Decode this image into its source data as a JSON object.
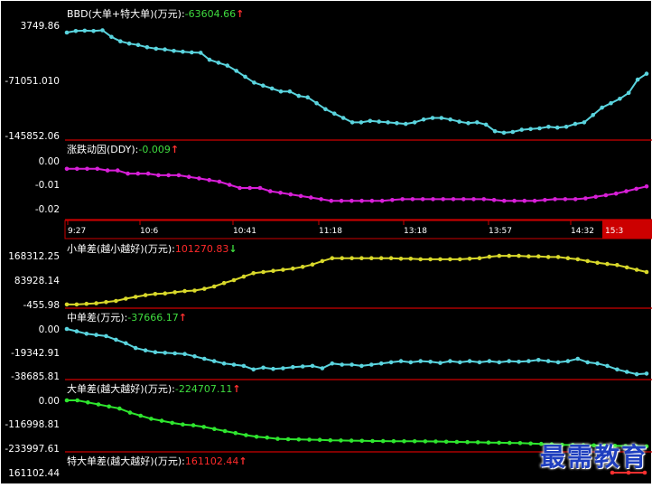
{
  "colors": {
    "background": "#000000",
    "frame": "#ffffff",
    "divider": "#cc0000",
    "axis_text": "#ffffff",
    "positive_value": "#ff2a2a",
    "negative_value": "#3fdc3f",
    "arrow_red": "#ff3030",
    "arrow_green": "#3fdc3f",
    "watermark": "#1f3fbf"
  },
  "watermark": "最需教育",
  "time_axis": {
    "labels": [
      "9:27",
      "10:6",
      "10:41",
      "11:18",
      "13:18",
      "13:57",
      "14:32",
      "15:3"
    ],
    "highlight": "15:3"
  },
  "chart_data": [
    {
      "type": "line",
      "id": "bbd",
      "label": "BBD(大单+特大单)(万元):",
      "value_text": "-63604.66",
      "arrow": "↑",
      "value_color": "#3fdc3f",
      "arrow_color": "#ff3030",
      "color": "#5ad4de",
      "y_ticks": [
        "3749.86",
        "-71051.010",
        "-145852.06"
      ],
      "ylim": [
        -145852.06,
        3749.86
      ],
      "values": [
        -6000,
        -4000,
        -3500,
        -4000,
        -3000,
        -12000,
        -18000,
        -21000,
        -23000,
        -26000,
        -28000,
        -29000,
        -31000,
        -32000,
        -33000,
        -33500,
        -43000,
        -47000,
        -51000,
        -58000,
        -66000,
        -74000,
        -78000,
        -82000,
        -86000,
        -86000,
        -92000,
        -94000,
        -102000,
        -110000,
        -116000,
        -122000,
        -128000,
        -128000,
        -126000,
        -127000,
        -128000,
        -129000,
        -130000,
        -128000,
        -124000,
        -122000,
        -122000,
        -124000,
        -127000,
        -129000,
        -128000,
        -131000,
        -140000,
        -142000,
        -141000,
        -138000,
        -137000,
        -136000,
        -134000,
        -135000,
        -134000,
        -130000,
        -128000,
        -118000,
        -108000,
        -102000,
        -96000,
        -88000,
        -70000,
        -62000
      ]
    },
    {
      "type": "line",
      "id": "ddy",
      "label": "涨跌动因(DDY):",
      "value_text": "-0.009",
      "arrow": "↑",
      "value_color": "#3fdc3f",
      "arrow_color": "#ff3030",
      "color": "#d81fd8",
      "y_ticks": [
        "0.00",
        "-0.01",
        "-0.02"
      ],
      "ylim": [
        -0.025,
        0.005
      ],
      "values": [
        0.0,
        0.0,
        0.0,
        0.0,
        -0.001,
        -0.001,
        -0.003,
        -0.003,
        -0.003,
        -0.004,
        -0.004,
        -0.004,
        -0.005,
        -0.006,
        -0.007,
        -0.008,
        -0.01,
        -0.012,
        -0.012,
        -0.012,
        -0.014,
        -0.015,
        -0.016,
        -0.017,
        -0.018,
        -0.019,
        -0.02,
        -0.02,
        -0.02,
        -0.02,
        -0.02,
        -0.02,
        -0.0195,
        -0.019,
        -0.019,
        -0.019,
        -0.019,
        -0.019,
        -0.019,
        -0.019,
        -0.019,
        -0.019,
        -0.0195,
        -0.02,
        -0.02,
        -0.02,
        -0.02,
        -0.0195,
        -0.019,
        -0.019,
        -0.019,
        -0.0185,
        -0.0175,
        -0.0165,
        -0.0155,
        -0.014,
        -0.0125,
        -0.011
      ]
    },
    {
      "type": "line",
      "id": "small",
      "label": "小单差(越小越好)(万元):",
      "value_text": "101270.83",
      "arrow": "↓",
      "value_color": "#ff2a2a",
      "arrow_color": "#3fdc3f",
      "color": "#d8d82a",
      "y_ticks": [
        "168312.25",
        "83928.14",
        "-455.98"
      ],
      "ylim": [
        -455.98,
        168312.25
      ],
      "values": [
        0,
        0,
        2000,
        4000,
        8000,
        12000,
        20000,
        26000,
        32000,
        36000,
        38000,
        42000,
        46000,
        48000,
        54000,
        62000,
        74000,
        84000,
        96000,
        108000,
        112000,
        116000,
        120000,
        124000,
        130000,
        138000,
        150000,
        160000,
        160000,
        160000,
        160000,
        160000,
        160000,
        160000,
        158000,
        158000,
        156000,
        156000,
        156000,
        156000,
        156000,
        158000,
        160000,
        165000,
        168000,
        168000,
        168000,
        166000,
        166000,
        164000,
        164000,
        160000,
        156000,
        150000,
        144000,
        140000,
        136000,
        128000,
        120000,
        112000
      ]
    },
    {
      "type": "line",
      "id": "medium",
      "label": "中单差(万元):",
      "value_text": "-37666.17",
      "arrow": "↑",
      "value_color": "#3fdc3f",
      "arrow_color": "#ff3030",
      "color": "#5ad4de",
      "y_ticks": [
        "0.00",
        "-19342.91",
        "-38685.81"
      ],
      "ylim": [
        -38685.81,
        0
      ],
      "values": [
        0,
        -2000,
        -4000,
        -5000,
        -6000,
        -9000,
        -12000,
        -16000,
        -18000,
        -19500,
        -20000,
        -20500,
        -21000,
        -23000,
        -25000,
        -27000,
        -29000,
        -30000,
        -31000,
        -34000,
        -32500,
        -33500,
        -33000,
        -32000,
        -31500,
        -31000,
        -33000,
        -29000,
        -30000,
        -30000,
        -31000,
        -30000,
        -29000,
        -28000,
        -27000,
        -28000,
        -27000,
        -27500,
        -28500,
        -27000,
        -28000,
        -27000,
        -28000,
        -27000,
        -28000,
        -27000,
        -27500,
        -27000,
        -26000,
        -27000,
        -28000,
        -27000,
        -25000,
        -28000,
        -29000,
        -31000,
        -34000,
        -36000,
        -38000,
        -37500
      ]
    },
    {
      "type": "line",
      "id": "large",
      "label": "大单差(越大越好)(万元):",
      "value_text": "-224707.11",
      "arrow": "↑",
      "value_color": "#3fdc3f",
      "arrow_color": "#ff3030",
      "color": "#2ee62e",
      "y_ticks": [
        "0.00",
        "-116998.81",
        "-233997.61"
      ],
      "ylim": [
        -233997.61,
        0
      ],
      "values": [
        0,
        0,
        -10000,
        -20000,
        -30000,
        -40000,
        -60000,
        -75000,
        -90000,
        -100000,
        -110000,
        -118000,
        -122000,
        -130000,
        -140000,
        -150000,
        -160000,
        -170000,
        -178000,
        -182000,
        -188000,
        -190000,
        -191000,
        -192000,
        -193000,
        -195000,
        -196000,
        -197000,
        -198000,
        -198500,
        -199000,
        -199500,
        -200000,
        -200000,
        -200500,
        -201000,
        -202000,
        -203000,
        -204000,
        -205000,
        -206000,
        -207000,
        -208000,
        -209000,
        -211000,
        -213000,
        -215000,
        -217000,
        -218000,
        -219000,
        -220000,
        -221000,
        -222000,
        -223000,
        -224000,
        -224707
      ]
    },
    {
      "type": "line",
      "id": "super",
      "label": "特大单差(越大越好)(万元):",
      "value_text": "161102.44",
      "arrow": "↑",
      "value_color": "#ff2a2a",
      "arrow_color": "#ff3030",
      "color": "#ff3030",
      "y_ticks": [
        "161102.44"
      ],
      "ylim": [
        155000,
        165000
      ],
      "values": [
        155500,
        158000,
        161102
      ]
    }
  ]
}
